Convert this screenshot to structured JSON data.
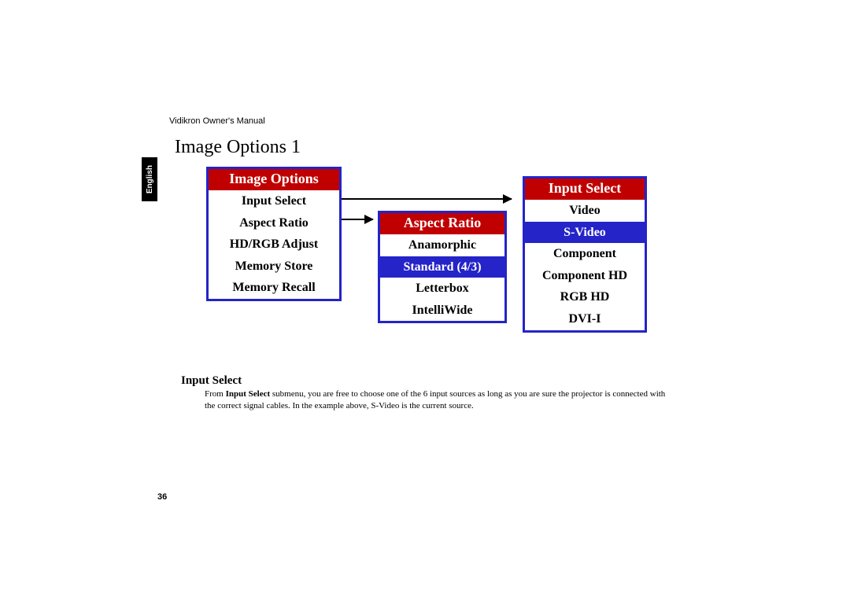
{
  "header": "Vidikron Owner's Manual",
  "section_title": "Image Options 1",
  "language_tab": "English",
  "menus": {
    "image_options": {
      "title": "Image Options",
      "items": [
        "Input Select",
        "Aspect Ratio",
        "HD/RGB Adjust",
        "Memory Store",
        "Memory Recall"
      ],
      "selected_index": -1
    },
    "aspect_ratio": {
      "title": "Aspect Ratio",
      "items": [
        "Anamorphic",
        "Standard (4/3)",
        "Letterbox",
        "IntelliWide"
      ],
      "selected_index": 1
    },
    "input_select": {
      "title": "Input Select",
      "items": [
        "Video",
        "S-Video",
        "Component",
        "Component HD",
        "RGB HD",
        "DVI-I"
      ],
      "selected_index": 1
    }
  },
  "subsection": {
    "heading": "Input Select",
    "body_prefix": "From ",
    "body_bold": "Input Select",
    "body_rest": " submenu, you are free to choose one of the 6 input sources as long as you are sure the projector is connected with the correct signal cables. In the example above, S-Video is the current source."
  },
  "page_number": "36"
}
